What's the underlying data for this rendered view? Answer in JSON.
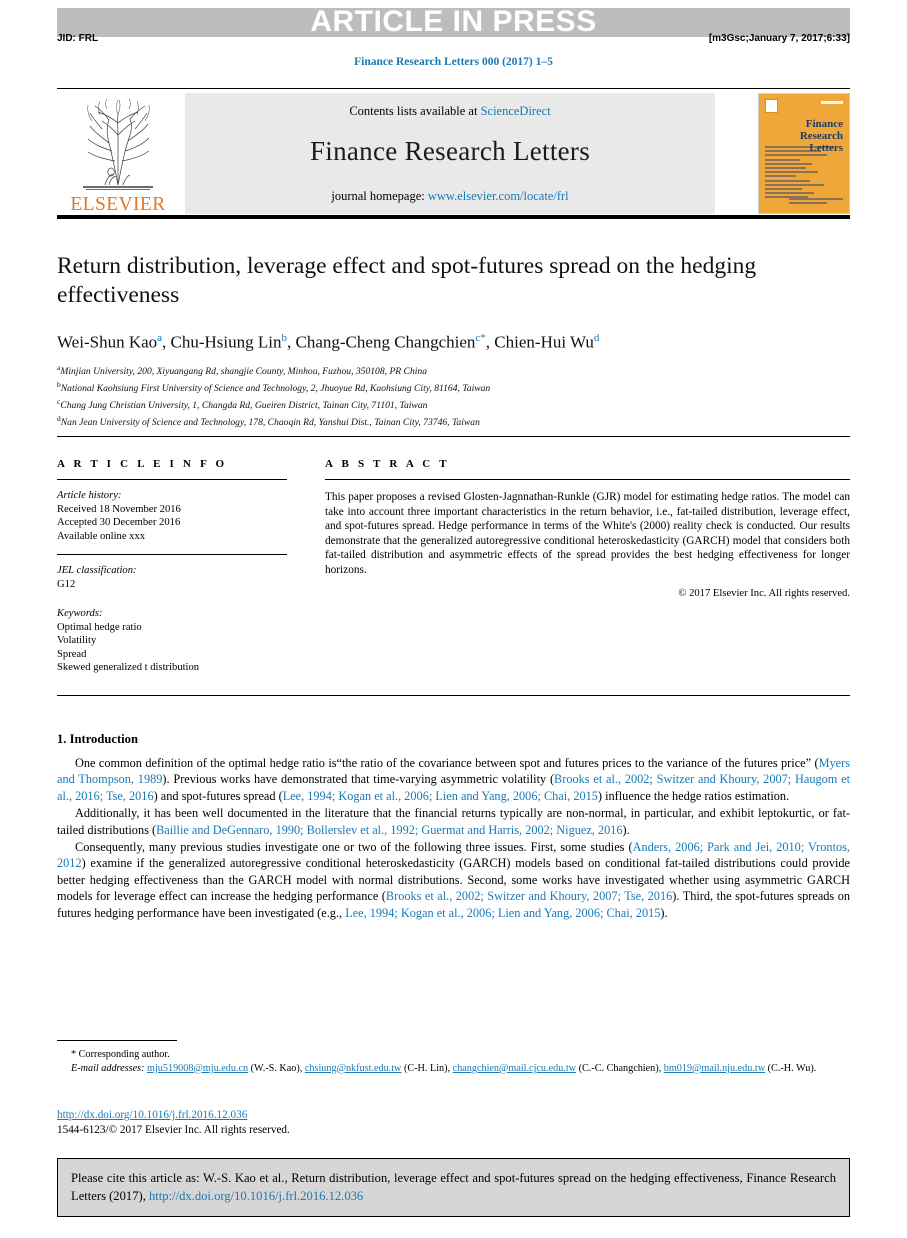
{
  "banner": {
    "text": "ARTICLE IN PRESS"
  },
  "runninghead": {
    "jid": "JID: FRL",
    "stamp": "[m3Gsc;January 7, 2017;6:33]"
  },
  "journal_citation": "Finance Research Letters 000 (2017) 1–5",
  "masthead": {
    "contents_prefix": "Contents lists available at ",
    "contents_link": "ScienceDirect",
    "journal_title": "Finance Research Letters",
    "homepage_prefix": "journal homepage: ",
    "homepage_link": "www.elsevier.com/locate/frl",
    "publisher_logo": "ELSEVIER",
    "cover_title": "Finance Research Letters"
  },
  "article": {
    "title": "Return distribution, leverage effect and spot-futures spread on the hedging effectiveness",
    "authors": [
      {
        "name": "Wei-Shun Kao",
        "marker": "a",
        "corresponding": false
      },
      {
        "name": "Chu-Hsiung Lin",
        "marker": "b",
        "corresponding": false
      },
      {
        "name": "Chang-Cheng Changchien",
        "marker": "c",
        "corresponding": true
      },
      {
        "name": "Chien-Hui Wu",
        "marker": "d",
        "corresponding": false
      }
    ],
    "affiliations": [
      {
        "marker": "a",
        "text": "Minjian University, 200, Xiyuangang Rd, shangjie County, Minhou, Fuzhou, 350108, PR China"
      },
      {
        "marker": "b",
        "text": "National Kaohsiung First University of Science and Technology, 2, Jhuoyue Rd, Kaohsiung City, 81164, Taiwan"
      },
      {
        "marker": "c",
        "text": "Chang Jung Christian University, 1, Changda Rd, Gueiren District, Tainan City, 71101, Taiwan"
      },
      {
        "marker": "d",
        "text": "Nan Jean University of Science and Technology, 178, Chaoqin Rd, Yanshui Dist., Tainan City, 73746, Taiwan"
      }
    ]
  },
  "article_info": {
    "heading": "A R T I C L E   I N F O",
    "history_label": "Article history:",
    "history": [
      "Received 18 November 2016",
      "Accepted 30 December 2016",
      "Available online xxx"
    ],
    "jel_label": "JEL classification:",
    "jel_values": [
      "G12"
    ],
    "keywords_label": "Keywords:",
    "keywords": [
      "Optimal hedge ratio",
      "Volatility",
      "Spread",
      "Skewed generalized t distribution"
    ]
  },
  "abstract": {
    "heading": "A B S T R A C T",
    "text": "This paper proposes a revised Glosten-Jagnnathan-Runkle (GJR) model for estimating hedge ratios. The model can take into account three important characteristics in the return behavior, i.e., fat-tailed distribution, leverage effect, and spot-futures spread. Hedge performance in terms of the White's (2000) reality check is conducted. Our results demonstrate that the generalized autoregressive conditional heteroskedasticity (GARCH) model that considers both fat-tailed distribution and asymmetric effects of the spread provides the best hedging effectiveness for longer horizons.",
    "copyright": "© 2017 Elsevier Inc. All rights reserved."
  },
  "body": {
    "section_heading": "1. Introduction",
    "paragraphs": [
      {
        "parts": [
          {
            "type": "text",
            "t": "One common definition of the optimal hedge ratio is“the ratio of the covariance between spot and futures prices to the variance of the futures price” ("
          },
          {
            "type": "cite",
            "t": "Myers and Thompson, 1989"
          },
          {
            "type": "text",
            "t": "). Previous works have demonstrated that time-varying asymmetric volatility ("
          },
          {
            "type": "cite",
            "t": "Brooks et al., 2002; Switzer and Khoury, 2007; Haugom et al., 2016; Tse, 2016"
          },
          {
            "type": "text",
            "t": ") and spot-futures spread ("
          },
          {
            "type": "cite",
            "t": "Lee, 1994; Kogan et al., 2006; Lien and Yang, 2006; Chai, 2015"
          },
          {
            "type": "text",
            "t": ") influence the hedge ratios estimation."
          }
        ]
      },
      {
        "parts": [
          {
            "type": "text",
            "t": "Additionally, it has been well documented in the literature that the financial returns typically are non-normal, in particular, and exhibit leptokurtic, or fat-tailed distributions ("
          },
          {
            "type": "cite",
            "t": "Baillie and DeGennaro, 1990; Bollerslev et al., 1992; Guermat and Harris, 2002; Niguez, 2016"
          },
          {
            "type": "text",
            "t": ")."
          }
        ]
      },
      {
        "parts": [
          {
            "type": "text",
            "t": "Consequently, many previous studies investigate one or two of the following three issues. First, some studies ("
          },
          {
            "type": "cite",
            "t": "Anders, 2006; Park and Jei, 2010; Vrontos, 2012"
          },
          {
            "type": "text",
            "t": ") examine if the generalized autoregressive conditional heteroskedasticity (GARCH) models based on conditional fat-tailed distributions could provide better hedging effectiveness than the GARCH model with normal distributions. Second, some works have investigated whether using asymmetric GARCH models for leverage effect can increase the hedging performance ("
          },
          {
            "type": "cite",
            "t": "Brooks et al., 2002; Switzer and Khoury, 2007; Tse, 2016"
          },
          {
            "type": "text",
            "t": "). Third, the spot-futures spreads on futures hedging performance have been investigated (e.g., "
          },
          {
            "type": "cite",
            "t": "Lee, 1994; Kogan et al., 2006; Lien and Yang, 2006; Chai, 2015"
          },
          {
            "type": "text",
            "t": ")."
          }
        ]
      }
    ]
  },
  "footnotes": {
    "corresponding": "* Corresponding author.",
    "email_label": "E-mail addresses:",
    "emails": [
      {
        "address": "mju519008@mju.edu.cn",
        "owner": "(W.-S. Kao)"
      },
      {
        "address": "chsiung@nkfust.edu.tw",
        "owner": "(C-H. Lin)"
      },
      {
        "address": "changchien@mail.cjcu.edu.tw",
        "owner": "(C.-C. Changchien)"
      },
      {
        "address": "bm019@mail.nju.edu.tw",
        "owner": "(C.-H. Wu)"
      }
    ],
    "doi": "http://dx.doi.org/10.1016/j.frl.2016.12.036",
    "issn_line": "1544-6123/© 2017 Elsevier Inc. All rights reserved."
  },
  "cite_box": {
    "prefix": "Please cite this article as: W.-S. Kao et al., Return distribution, leverage effect and spot-futures spread on the hedging effectiveness, Finance Research Letters (2017), ",
    "link": "http://dx.doi.org/10.1016/j.frl.2016.12.036"
  },
  "colors": {
    "link": "#1a7ab5",
    "banner_bg": "#bdbdbd",
    "masthead_bg": "#e9e9e9",
    "cover_bg": "#f0a73a",
    "cite_box_bg": "#d6d6d6",
    "elsevier_orange": "#e87722"
  }
}
